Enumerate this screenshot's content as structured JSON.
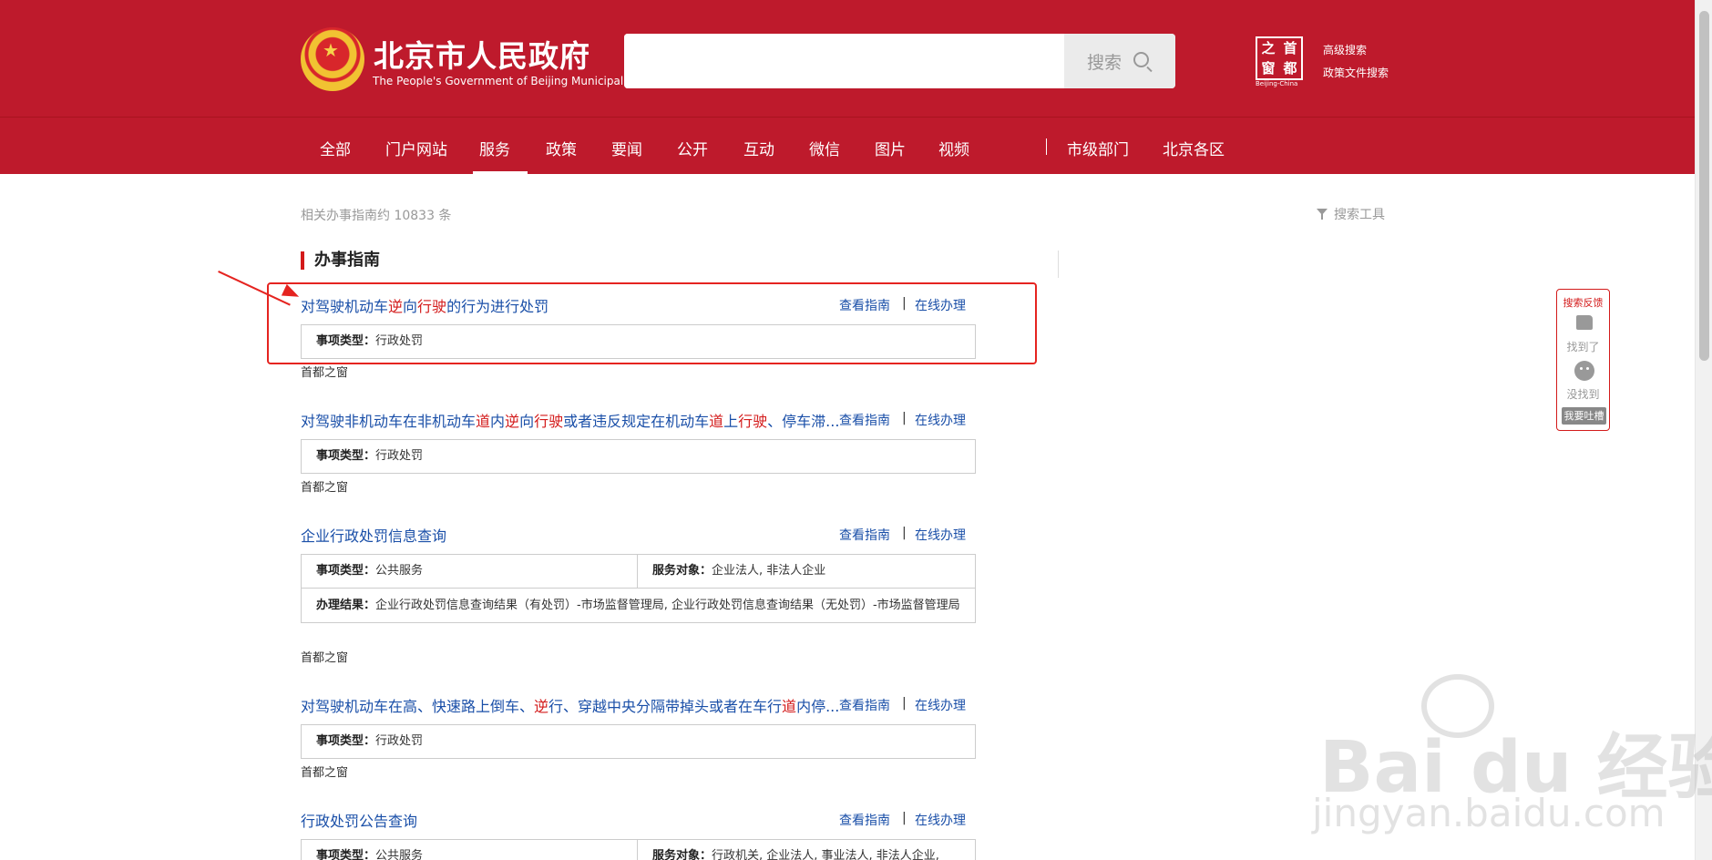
{
  "header": {
    "logo_cn": "北京市人民政府",
    "logo_en": "The People's Government of Beijing Municipality",
    "search_placeholder": "",
    "search_button": "搜索",
    "capital_logo": [
      "之",
      "首",
      "窗",
      "都"
    ],
    "capital_sub": "Beijing-China",
    "advanced_search": "高级搜索",
    "policy_search": "政策文件搜索"
  },
  "nav": {
    "items": [
      "全部",
      "门户网站",
      "服务",
      "政策",
      "要闻",
      "公开",
      "互动",
      "微信",
      "图片",
      "视频",
      "市级部门",
      "北京各区"
    ],
    "active": "服务"
  },
  "results": {
    "count_text": "相关办事指南约 10833 条",
    "tools_label": "搜索工具",
    "section_title": "办事指南",
    "view_guide": "查看指南",
    "separator": "|",
    "online_handle": "在线办理",
    "items": [
      {
        "title": [
          "对驾驶机动车",
          {
            "hl": "逆"
          },
          "向",
          {
            "hl": "行驶"
          },
          "的行为进行处罚"
        ],
        "type_label": "事项类型：",
        "type_value": "行政处罚",
        "source": "首都之窗"
      },
      {
        "title": [
          "对驾驶非机动车在非机动车",
          {
            "hl": "道"
          },
          "内",
          {
            "hl": "逆"
          },
          "向",
          {
            "hl": "行驶"
          },
          "或者违反规定在机动车",
          {
            "hl": "道"
          },
          "上",
          {
            "hl": "行驶"
          },
          "、停车滞..."
        ],
        "type_label": "事项类型：",
        "type_value": "行政处罚",
        "source": "首都之窗"
      },
      {
        "title": [
          "企业行政处罚信息查询"
        ],
        "type_label": "事项类型：",
        "type_value": "公共服务",
        "target_label": "服务对象：",
        "target_value": "企业法人, 非法人企业",
        "result_label": "办理结果：",
        "result_value": "企业行政处罚信息查询结果（有处罚）-市场监督管理局, 企业行政处罚信息查询结果（无处罚）-市场监督管理局",
        "source": "首都之窗"
      },
      {
        "title": [
          "对驾驶机动车在高、快速路上倒车、",
          {
            "hl": "逆"
          },
          "行、穿越中央分隔带掉头或者在车行",
          {
            "hl": "道"
          },
          "内停..."
        ],
        "type_label": "事项类型：",
        "type_value": "行政处罚",
        "source": "首都之窗"
      },
      {
        "title": [
          "行政处罚公告查询"
        ],
        "type_label": "事项类型：",
        "type_value": "公共服务",
        "target_label": "服务对象：",
        "target_value": "行政机关, 企业法人, 事业法人, 非法人企业,"
      }
    ]
  },
  "feedback": {
    "title": "搜索反馈",
    "found": "找到了",
    "not_found": "没找到",
    "complain": "我要吐槽"
  },
  "watermark": {
    "main": "Bai du 经验",
    "sub": "jingyan.baidu.com"
  },
  "colors": {
    "brand_red": "#be1a2c",
    "link_blue": "#1a4fa8",
    "highlight_red": "#d31a1a",
    "annotation_red": "#e52420"
  }
}
